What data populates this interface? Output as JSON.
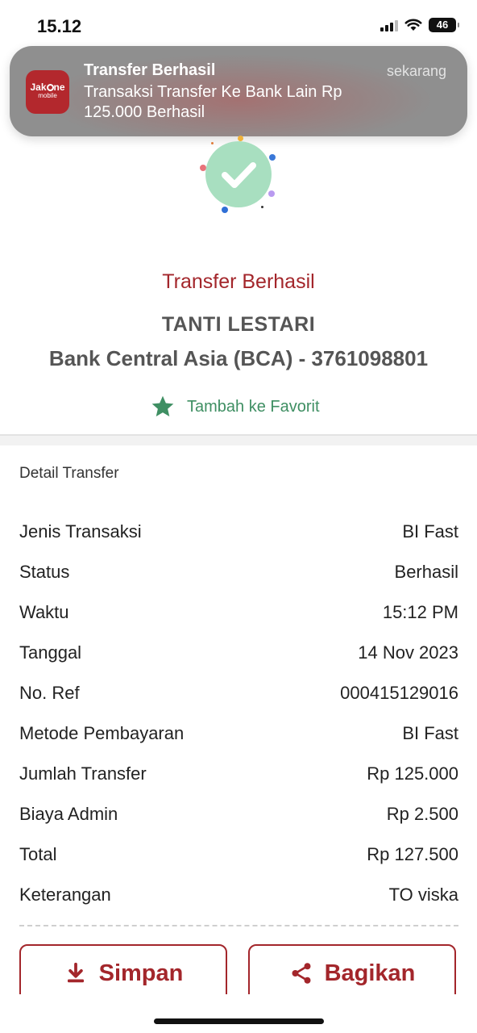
{
  "status_bar": {
    "time": "15.12",
    "battery": "46"
  },
  "notification": {
    "app_name": "JakOne mobile",
    "title": "Transfer Berhasil",
    "time": "sekarang",
    "body": "Transaksi Transfer Ke Bank Lain Rp 125.000 Berhasil"
  },
  "result": {
    "title": "Transfer Berhasil",
    "recipient_name": "TANTI LESTARI",
    "recipient_account": "Bank Central Asia (BCA) - 3761098801",
    "favorite_label": "Tambah ke Favorit"
  },
  "detail": {
    "section_title": "Detail Transfer",
    "rows": [
      {
        "label": "Jenis Transaksi",
        "value": "BI Fast"
      },
      {
        "label": "Status",
        "value": "Berhasil"
      },
      {
        "label": "Waktu",
        "value": "15:12 PM"
      },
      {
        "label": "Tanggal",
        "value": "14 Nov 2023"
      },
      {
        "label": "No. Ref",
        "value": "000415129016"
      },
      {
        "label": "Metode Pembayaran",
        "value": "BI Fast"
      },
      {
        "label": "Jumlah Transfer",
        "value": "Rp 125.000"
      },
      {
        "label": "Biaya Admin",
        "value": "Rp 2.500"
      },
      {
        "label": "Total",
        "value": "Rp 127.500"
      },
      {
        "label": "Keterangan",
        "value": "TO viska"
      }
    ]
  },
  "actions": {
    "save_label": "Simpan",
    "share_label": "Bagikan"
  },
  "colors": {
    "brand": "#a3262b",
    "success_green": "#3f8f63",
    "check_bg": "#a8dfc0"
  }
}
